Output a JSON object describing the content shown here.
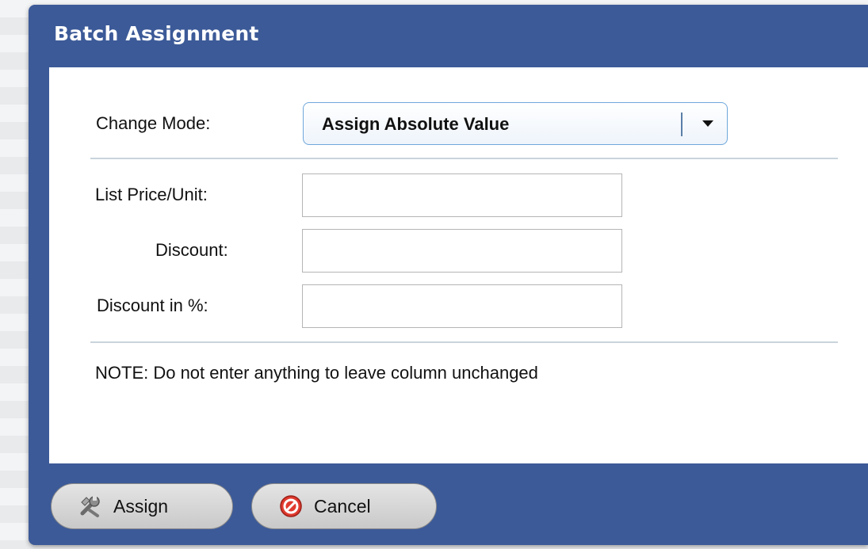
{
  "dialog": {
    "title": "Batch Assignment"
  },
  "form": {
    "change_mode": {
      "label": "Change Mode:",
      "selected": "Assign Absolute Value"
    },
    "list_price": {
      "label": "List Price/Unit:",
      "value": ""
    },
    "discount": {
      "label": "Discount:",
      "value": ""
    },
    "discount_pct": {
      "label": "Discount in %:",
      "value": ""
    },
    "note": "NOTE:  Do not enter anything to leave column unchanged"
  },
  "buttons": {
    "assign": {
      "label": "Assign",
      "icon": "wrench-icon"
    },
    "cancel": {
      "label": "Cancel",
      "icon": "cancel-icon"
    }
  },
  "colors": {
    "header": "#3c5a98",
    "select_border": "#6fa7db",
    "cancel_icon": "#e03a2e"
  }
}
